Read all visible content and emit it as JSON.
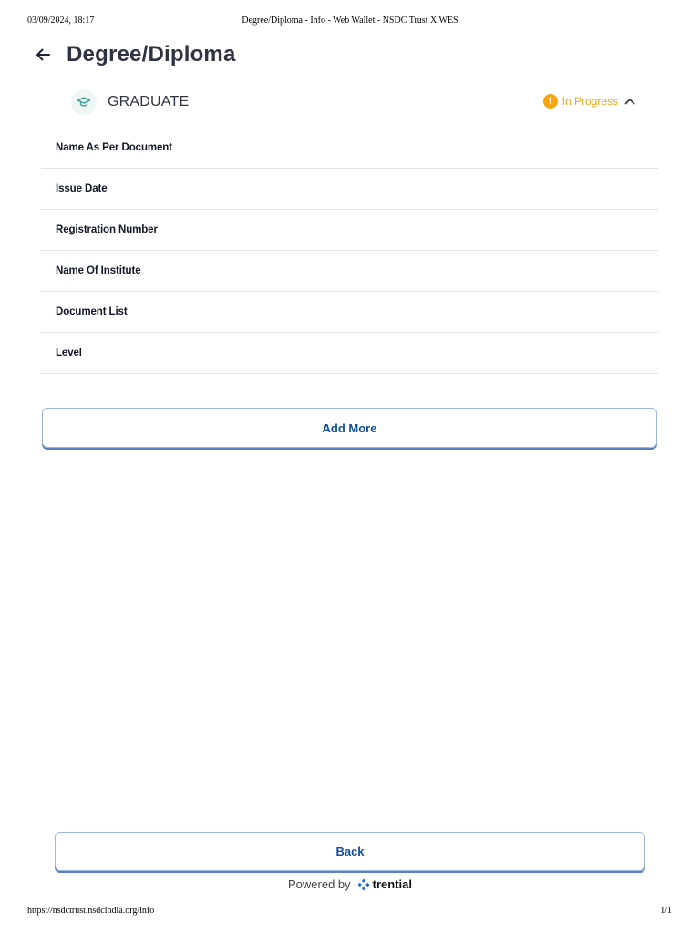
{
  "print_header": {
    "datetime": "03/09/2024, 18:17",
    "title": "Degree/Diploma - Info - Web Wallet - NSDC Trust X WES"
  },
  "page": {
    "title": "Degree/Diploma"
  },
  "section": {
    "title": "GRADUATE",
    "icon": "graduation-cap-icon",
    "status": {
      "text": "In Progress",
      "symbol": "!",
      "color": "#f5a512"
    }
  },
  "fields": [
    {
      "label": "Name As Per Document"
    },
    {
      "label": "Issue Date"
    },
    {
      "label": "Registration Number"
    },
    {
      "label": "Name Of Institute"
    },
    {
      "label": "Document List"
    },
    {
      "label": "Level"
    }
  ],
  "buttons": {
    "add_more": "Add More",
    "back": "Back"
  },
  "footer": {
    "powered_by": "Powered by",
    "brand": "trential"
  },
  "print_footer": {
    "url": "https://nsdctrust.nsdcindia.org/info",
    "page": "1/1"
  },
  "colors": {
    "accent_blue": "#0f4ea3",
    "status_orange": "#f5a512",
    "title_dark": "#2f3342"
  }
}
